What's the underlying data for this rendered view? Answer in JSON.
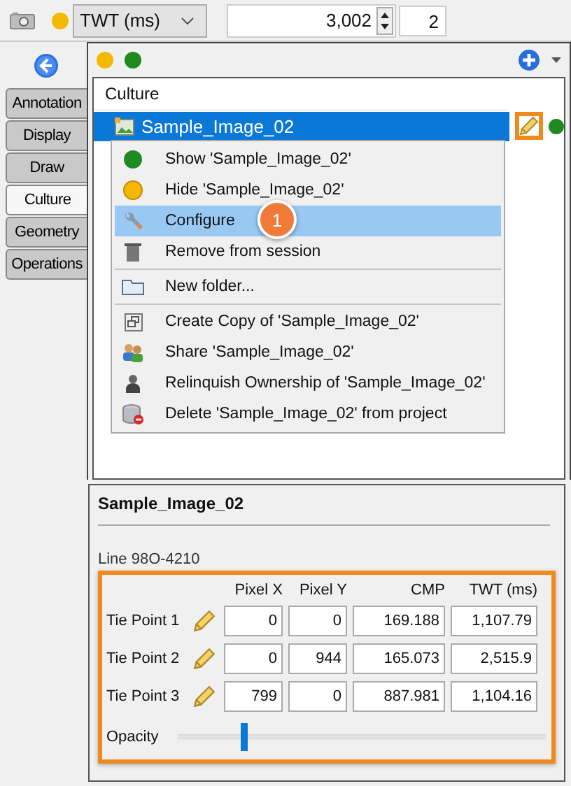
{
  "toolbar": {
    "status_dot": {
      "color": "#f5b800"
    },
    "domain": "TWT (ms)",
    "value": "3,002",
    "step": "2"
  },
  "side_tabs": [
    {
      "label": "Annotation",
      "selected": false
    },
    {
      "label": "Display",
      "selected": false
    },
    {
      "label": "Draw",
      "selected": false
    },
    {
      "label": "Culture",
      "selected": true
    },
    {
      "label": "Geometry",
      "selected": false
    },
    {
      "label": "Operations",
      "selected": false
    }
  ],
  "panel": {
    "status_dots": [
      {
        "color": "#f5b800"
      },
      {
        "color": "#1f8a1f"
      }
    ],
    "tree": {
      "header": "Culture",
      "items": [
        {
          "label": "Sample_Image_02",
          "selected": true,
          "highlighted": true,
          "status_dot": {
            "color": "#1f8a1f"
          }
        }
      ]
    }
  },
  "context_menu": {
    "items": [
      {
        "kind": "show",
        "label": "Show 'Sample_Image_02'",
        "selected": false
      },
      {
        "kind": "hide",
        "label": "Hide 'Sample_Image_02'",
        "selected": false
      },
      {
        "kind": "configure",
        "label": "Configure",
        "selected": true
      },
      {
        "kind": "remove",
        "label": "Remove from session",
        "selected": false
      },
      {
        "kind": "separator"
      },
      {
        "kind": "folder",
        "label": "New folder...",
        "selected": false
      },
      {
        "kind": "separator"
      },
      {
        "kind": "copy",
        "label": "Create Copy of 'Sample_Image_02'",
        "selected": false
      },
      {
        "kind": "share",
        "label": "Share 'Sample_Image_02'",
        "selected": false
      },
      {
        "kind": "relinquish",
        "label": "Relinquish Ownership of 'Sample_Image_02'",
        "selected": false
      },
      {
        "kind": "delete",
        "label": "Delete 'Sample_Image_02' from project",
        "selected": false
      }
    ]
  },
  "callout": {
    "label": "1"
  },
  "details": {
    "title": "Sample_Image_02",
    "line": "Line  98O-4210",
    "highlighted": true,
    "columns": [
      "Pixel X",
      "Pixel Y",
      "CMP",
      "TWT (ms)"
    ],
    "rows": [
      {
        "label": "Tie Point 1",
        "values": [
          "0",
          "0",
          "169.188",
          "1,107.79"
        ]
      },
      {
        "label": "Tie Point 2",
        "values": [
          "0",
          "944",
          "165.073",
          "2,515.9"
        ]
      },
      {
        "label": "Tie Point 3",
        "values": [
          "799",
          "0",
          "887.981",
          "1,104.16"
        ]
      }
    ],
    "opacity": {
      "label": "Opacity",
      "level": 0.17
    }
  }
}
